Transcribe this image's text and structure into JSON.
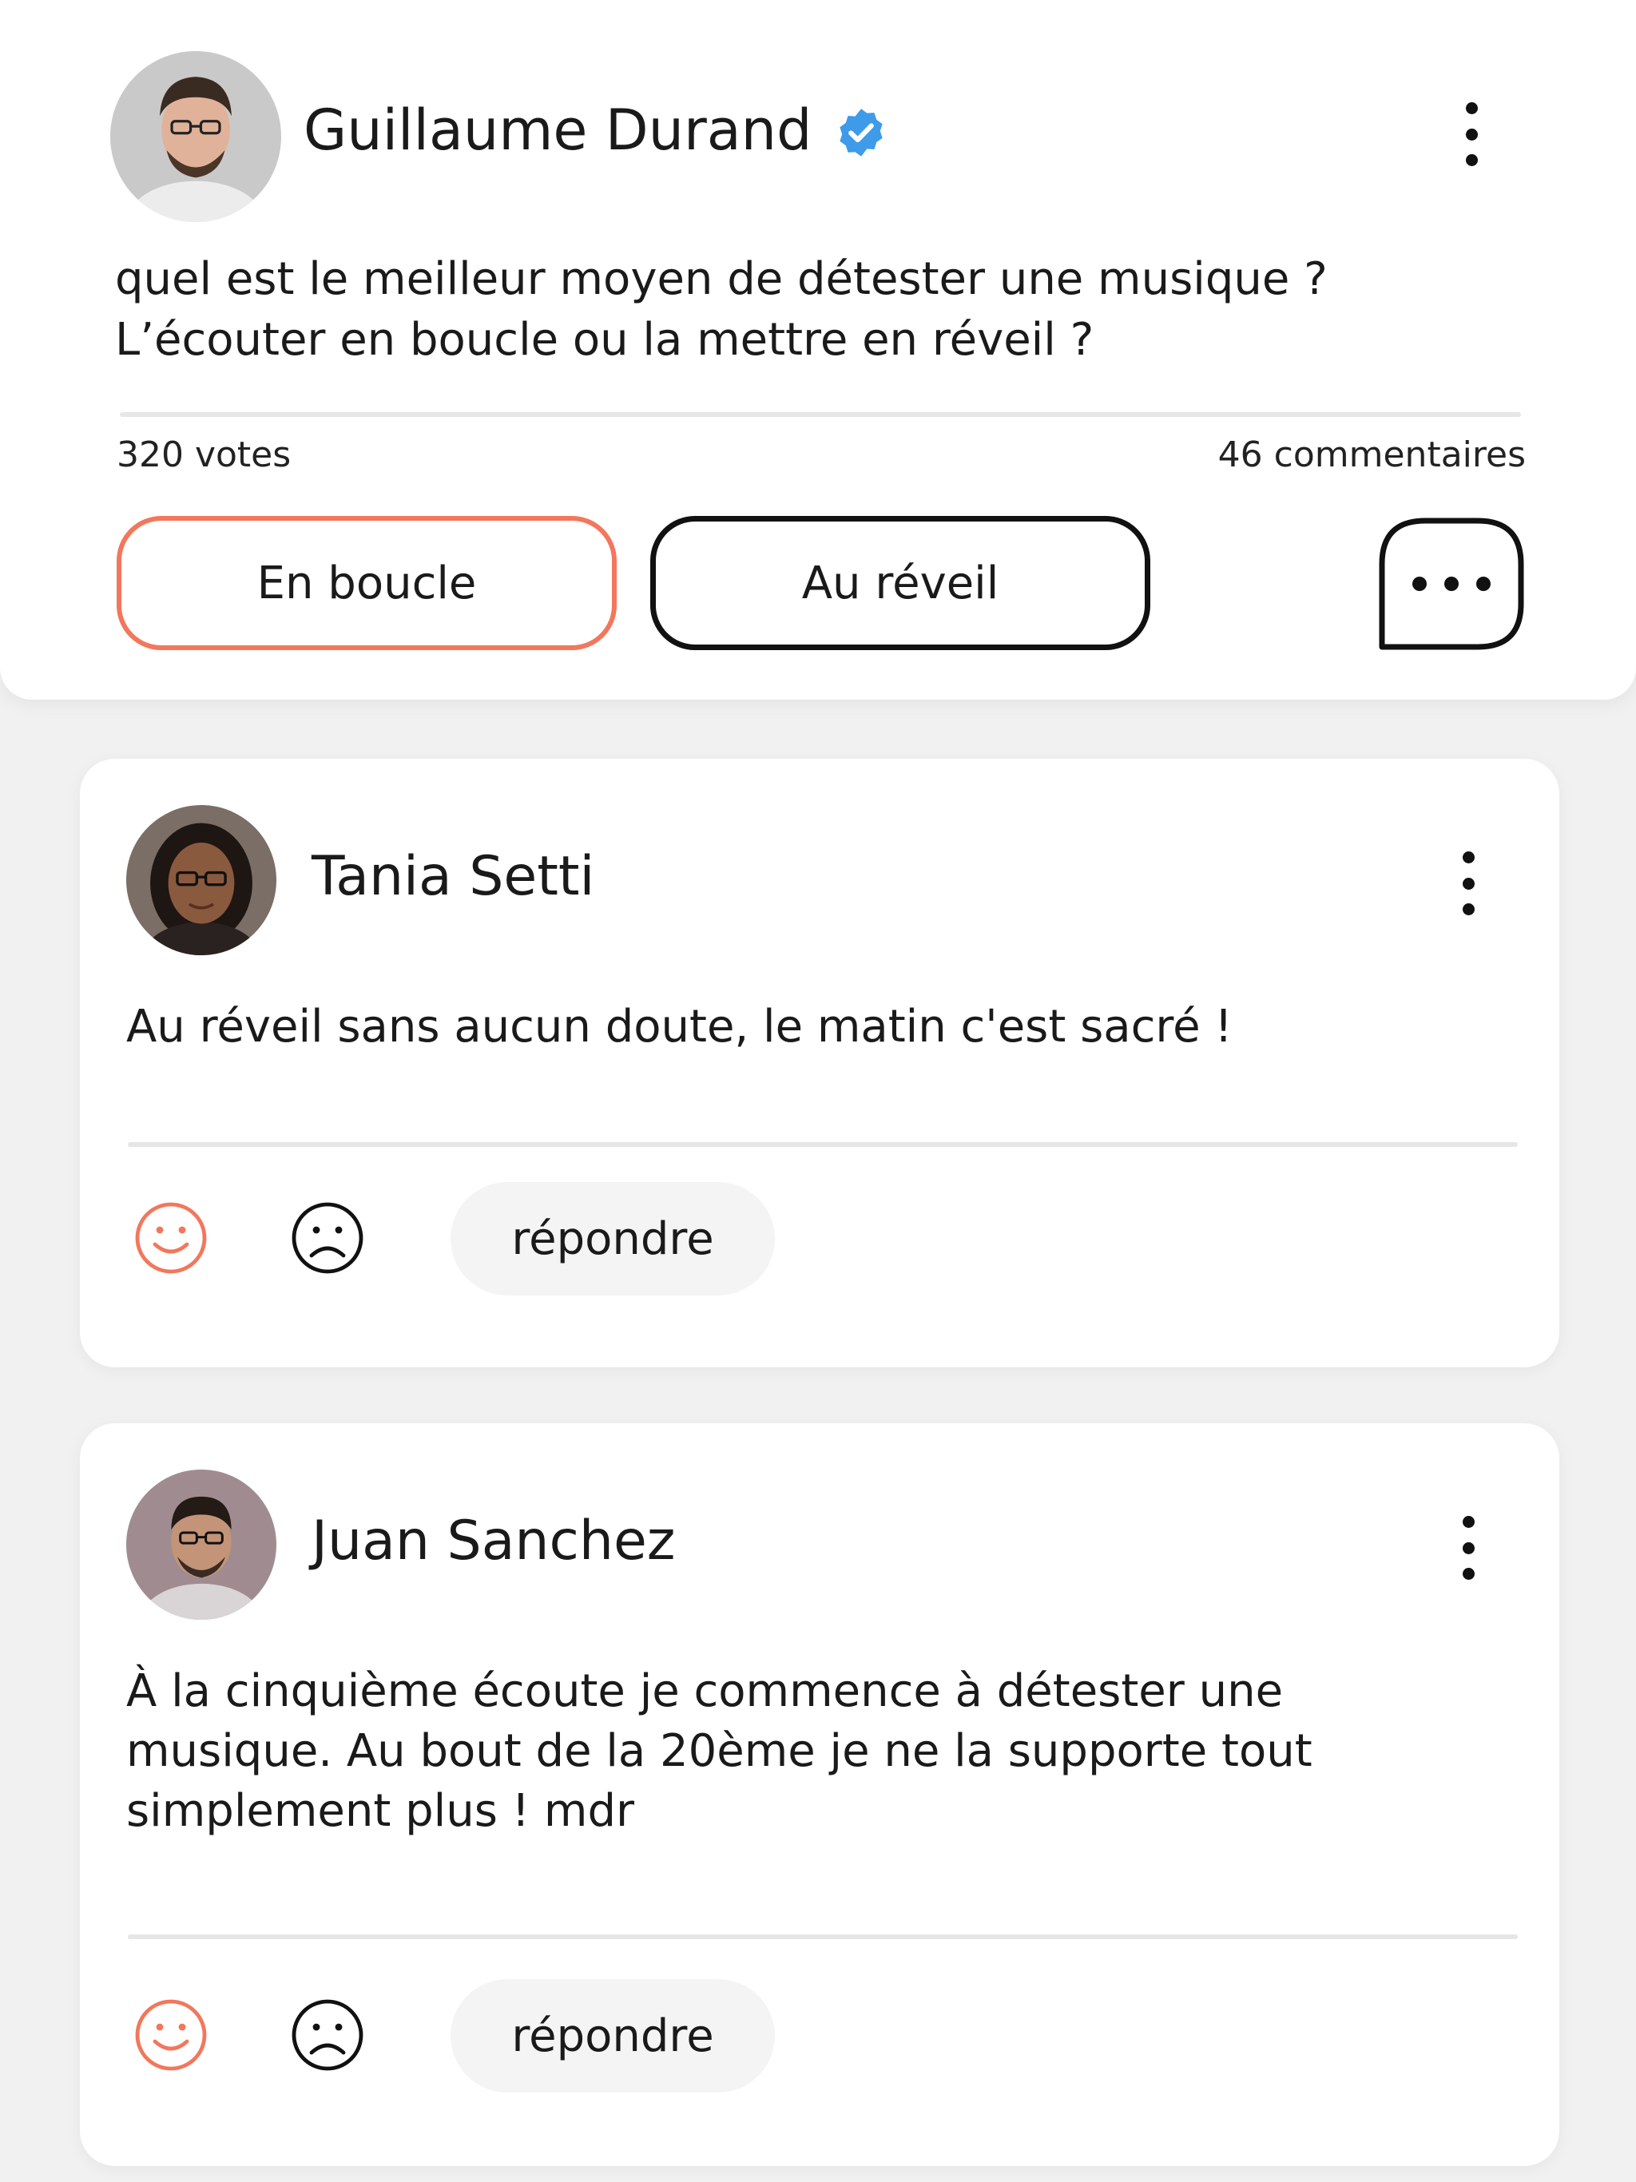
{
  "post": {
    "author": "Guillaume Durand",
    "verified": true,
    "question_line1": "quel est le meilleur moyen de détester une musique ?",
    "question_line2": "L’écouter en boucle ou la mettre en réveil ?",
    "votes": "320 votes",
    "comments": "46 commentaires",
    "options": [
      {
        "label": "En boucle",
        "selected": true
      },
      {
        "label": "Au réveil",
        "selected": false
      }
    ],
    "comment_button_icon": "speech-bubble-ellipsis-icon"
  },
  "comments": [
    {
      "author": "Tania Setti",
      "text": "Au réveil sans aucun doute, le matin c'est sacré !",
      "reply_label": "répondre"
    },
    {
      "author": "Juan Sanchez",
      "text": "À la cinquième écoute je commence à détester une musique. Au bout de la 20ème je ne la supporte tout simplement plus ! mdr",
      "reply_label": "répondre"
    }
  ],
  "icons": {
    "like": "smiley-face-icon",
    "dislike": "sad-face-icon",
    "more": "kebab-menu-icon",
    "verified": "verified-badge-icon"
  },
  "colors": {
    "accent": "#f2775c",
    "verified": "#3d9be9",
    "background": "#f1f1f1",
    "card": "#ffffff"
  }
}
